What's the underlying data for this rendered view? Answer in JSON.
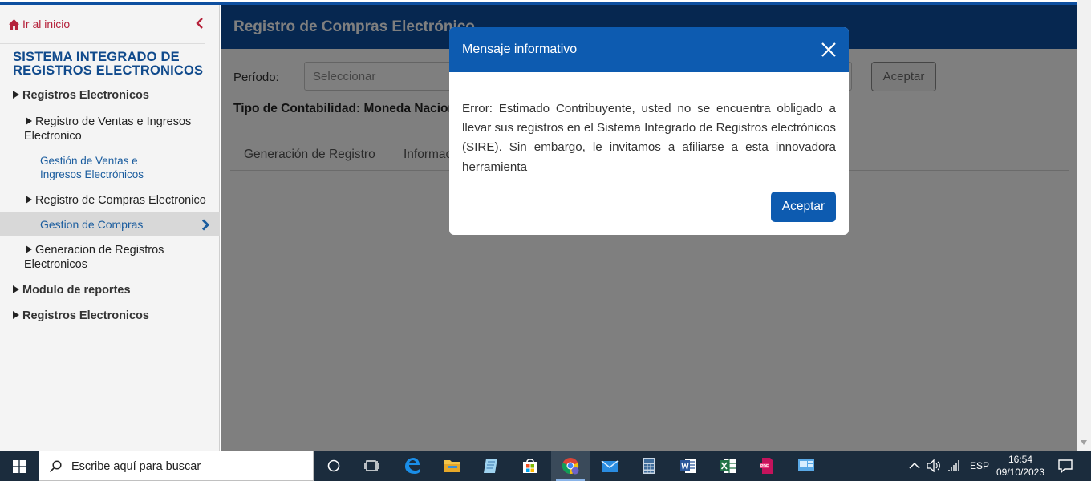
{
  "sidebar": {
    "home_label": "Ir al inicio",
    "system_title": "SISTEMA INTEGRADO DE REGISTROS ELECTRONICOS",
    "items": [
      {
        "label": "Registros Electronicos"
      },
      {
        "label": "Registro de Ventas e Ingresos Electronico"
      },
      {
        "label": "Gestión de Ventas e Ingresos Electrónicos"
      },
      {
        "label": "Registro de Compras Electronico"
      },
      {
        "label": "Gestion de Compras"
      },
      {
        "label": "Generacion de Registros Electronicos"
      },
      {
        "label": "Modulo de reportes"
      },
      {
        "label": "Registros Electronicos"
      }
    ]
  },
  "main": {
    "header_title": "Registro de Compras Electrónico",
    "periodo_label": "Período:",
    "periodo_placeholder": "Seleccionar",
    "aceptar_label": "Aceptar",
    "tipo_label": "Tipo de Contabilidad: Moneda Nacional",
    "tabs": [
      {
        "label": "Generación de Registro"
      },
      {
        "label": "Información"
      }
    ]
  },
  "modal": {
    "title": "Mensaje informativo",
    "message": "Error: Estimado Contribuyente, usted no se encuentra obligado a llevar sus registros en el Sistema Integrado de Registros electrónicos (SIRE). Sin embargo, le invitamos a afiliarse a esta innovadora herramienta",
    "accept_label": "Aceptar"
  },
  "taskbar": {
    "search_placeholder": "Escribe aquí para buscar",
    "language": "ESP",
    "time": "16:54",
    "date": "09/10/2023",
    "colors": {
      "background": "#1b2c3d",
      "accent": "#0d5bb0"
    }
  }
}
